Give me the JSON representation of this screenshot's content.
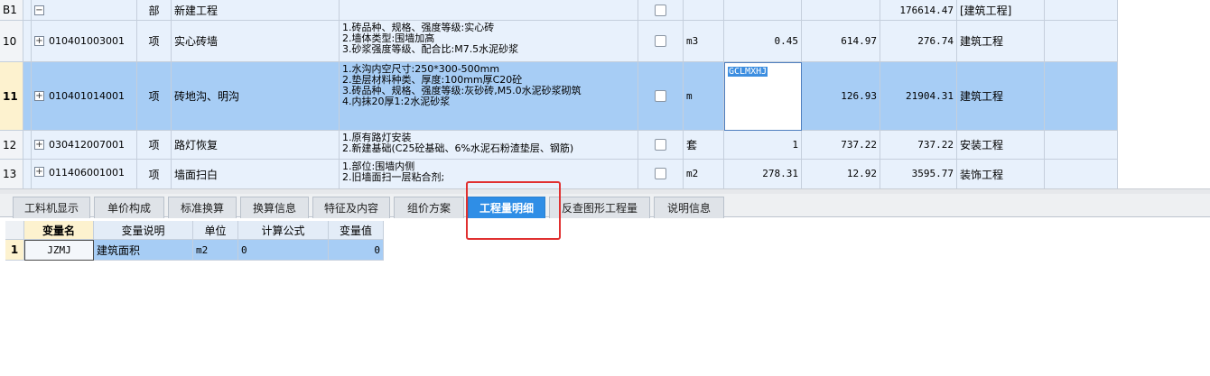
{
  "top_table": {
    "group_row": {
      "row_label": "B1",
      "type": "部",
      "name": "新建工程",
      "total": "176614.47",
      "category": "[建筑工程]"
    },
    "rows": [
      {
        "num": "10",
        "code": "010401003001",
        "type": "项",
        "name": "实心砖墙",
        "desc": [
          "1.砖品种、规格、强度等级:实心砖",
          "2.墙体类型:围墙加高",
          "3.砂浆强度等级、配合比:M7.5水泥砂浆"
        ],
        "unit": "m3",
        "qty": "0.45",
        "price": "614.97",
        "total": "276.74",
        "category": "建筑工程"
      },
      {
        "num": "11",
        "code": "010401014001",
        "type": "项",
        "name": "砖地沟、明沟",
        "desc": [
          "1.水沟内空尺寸:250*300-500mm",
          "2.垫层材料种类、厚度:100mm厚C20砼",
          "3.砖品种、规格、强度等级:灰砂砖,M5.0水泥砂浆砌筑",
          "4.内抹20厚1:2水泥砂浆"
        ],
        "unit": "m",
        "qty_edit": "GCLMXHJ",
        "price": "126.93",
        "total": "21904.31",
        "category": "建筑工程"
      },
      {
        "num": "12",
        "code": "030412007001",
        "type": "项",
        "name": "路灯恢复",
        "desc": [
          "1.原有路灯安装",
          "2.新建基础(C25砼基础、6%水泥石粉渣垫层、钢筋)"
        ],
        "unit": "套",
        "qty": "1",
        "price": "737.22",
        "total": "737.22",
        "category": "安装工程"
      },
      {
        "num": "13",
        "code": "011406001001",
        "type": "项",
        "name": "墙面扫白",
        "desc": [
          "1.部位:围墙内侧",
          "2.旧墙面扫一层粘合剂;"
        ],
        "unit": "m2",
        "qty": "278.31",
        "price": "12.92",
        "total": "3595.77",
        "category": "装饰工程"
      }
    ]
  },
  "tabs": [
    {
      "label": "工料机显示"
    },
    {
      "label": "单价构成"
    },
    {
      "label": "标准换算"
    },
    {
      "label": "换算信息"
    },
    {
      "label": "特征及内容"
    },
    {
      "label": "组价方案"
    },
    {
      "label": "工程量明细"
    },
    {
      "label": "反查图形工程量"
    },
    {
      "label": "说明信息"
    }
  ],
  "active_tab": "工程量明细",
  "var_table": {
    "headers": [
      "变量名",
      "变量说明",
      "单位",
      "计算公式",
      "变量值"
    ],
    "rows": [
      {
        "num": "1",
        "name": "JZMJ",
        "desc": "建筑面积",
        "unit": "m2",
        "formula": "0",
        "value": "0"
      }
    ]
  },
  "colors": {
    "selected_row": "#a7cdf5",
    "alt_row": "#e8f1fc",
    "active_tab": "#2f8ee6",
    "highlight": "#e03030"
  }
}
